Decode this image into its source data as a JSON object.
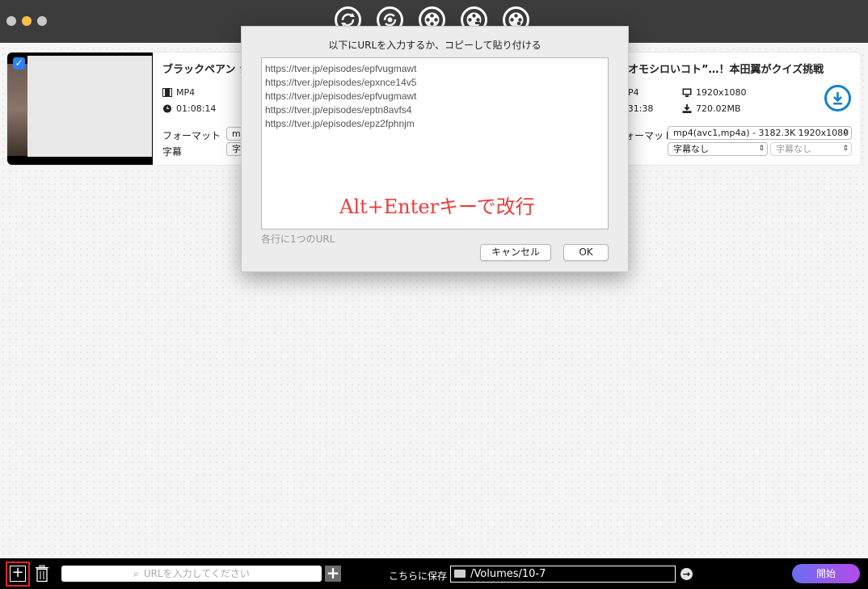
{
  "titlebar": {
    "icons": [
      "convert-icon",
      "convert-settings-icon",
      "film-reel-icon",
      "film-edit-icon",
      "film-audio-icon"
    ]
  },
  "item": {
    "title_left": "ブラックペアン シ",
    "title_right": "オモシロいコト”…！本田翼がクイズ挑戦",
    "format_left": "MP4",
    "duration_left": "01:08:14",
    "format_right_partial": "P4",
    "duration_right_partial": ":31:38",
    "resolution": "1920x1080",
    "size": "720.02MB",
    "format_label": "フォーマット",
    "subtitle_label": "字幕",
    "format_label_right_partial": "ォーマット",
    "format_select_partial": "mp",
    "subtitle_select_partial": "字",
    "format_select_right": "mp4(avc1,mp4a) - 3182.3K 1920x1080",
    "subtitle_select_right": "字幕なし",
    "subtitle2_select_right": "字幕なし"
  },
  "dialog": {
    "title": "以下にURLを入力するか、コピーして貼り付ける",
    "urls": [
      "https://tver.jp/episodes/epfvugmawt",
      "https://tver.jp/episodes/epxnce14v5",
      "https://tver.jp/episodes/epfvugmawt",
      "https://tver.jp/episodes/eptn8avfs4",
      "https://tver.jp/episodes/epz2fphnjm"
    ],
    "hint": "Alt+Enterキーで改行",
    "per_line_label": "各行に1つのURL",
    "cancel_label": "キャンセル",
    "ok_label": "OK",
    "hint_color": "#ee3b3b"
  },
  "bottombar": {
    "add_label": "+",
    "url_placeholder": "URLを入力してください",
    "plus_label": "+",
    "save_label": "こちらに保存",
    "save_path": "/Volumes/10-7",
    "go_label": "→",
    "start_label": "開始",
    "highlight_color": "#e8231b"
  }
}
